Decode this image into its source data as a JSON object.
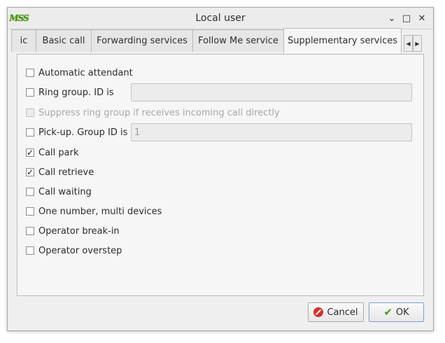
{
  "window": {
    "logo_text": "MSS",
    "title": "Local user",
    "controls": {
      "minimize": "⌄",
      "maximize": "□",
      "close": "✕"
    }
  },
  "tabs": [
    {
      "label": "ic",
      "active": false
    },
    {
      "label": "Basic call",
      "active": false
    },
    {
      "label": "Forwarding services",
      "active": false
    },
    {
      "label": "Follow Me service",
      "active": false
    },
    {
      "label": "Supplementary services",
      "active": true
    }
  ],
  "tab_scroll": {
    "left": "◀",
    "right": "▶"
  },
  "options": [
    {
      "label": "Automatic attendant",
      "checked": false,
      "enabled": true
    },
    {
      "label": "Ring group. ID is",
      "checked": false,
      "enabled": true,
      "field_value": ""
    },
    {
      "label": "Suppress ring group if receives incoming call directly",
      "checked": false,
      "enabled": false
    },
    {
      "label": "Pick-up. Group ID is",
      "checked": false,
      "enabled": true,
      "field_value": "1"
    },
    {
      "label": "Call park",
      "checked": true,
      "enabled": true
    },
    {
      "label": "Call retrieve",
      "checked": true,
      "enabled": true
    },
    {
      "label": "Call waiting",
      "checked": false,
      "enabled": true
    },
    {
      "label": "One number, multi devices",
      "checked": false,
      "enabled": true
    },
    {
      "label": "Operator break-in",
      "checked": false,
      "enabled": true
    },
    {
      "label": "Operator overstep",
      "checked": false,
      "enabled": true
    }
  ],
  "check_mark": "✓",
  "buttons": {
    "cancel": "Cancel",
    "ok": "OK"
  },
  "icons": {
    "cancel": "cancel-circle-icon",
    "ok": "checkmark-icon",
    "ok_glyph": "✔"
  }
}
